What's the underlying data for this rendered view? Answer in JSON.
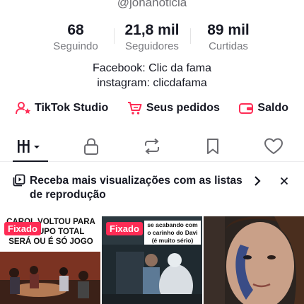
{
  "profile": {
    "handle": "@jonanoticia",
    "stats": [
      {
        "value": "68",
        "label": "Seguindo"
      },
      {
        "value": "21,8 mil",
        "label": "Seguidores"
      },
      {
        "value": "89 mil",
        "label": "Curtidas"
      }
    ],
    "bio": [
      "Facebook: Clic da fama",
      "instagram: clicdafama"
    ],
    "links": [
      {
        "label": "TikTok Studio",
        "icon": "person-star-icon"
      },
      {
        "label": "Seus pedidos",
        "icon": "cart-icon"
      },
      {
        "label": "Saldo",
        "icon": "wallet-icon"
      }
    ]
  },
  "tabs": [
    {
      "name": "videos",
      "icon": "grid-icon",
      "active": true
    },
    {
      "name": "private",
      "icon": "lock-icon"
    },
    {
      "name": "reposts",
      "icon": "repost-icon"
    },
    {
      "name": "favorites",
      "icon": "bookmark-icon"
    },
    {
      "name": "liked",
      "icon": "heart-icon"
    }
  ],
  "banner": {
    "text": "Receba mais visualizações com as listas de reprodução",
    "icon": "playlist-icon"
  },
  "videos": [
    {
      "pinned": "Fixado",
      "caption": "CAROL VOLTOU PARA O GRUPO TOTAL SERÁ OU É SÓ JOGO"
    },
    {
      "pinned": "Fixado",
      "caption": "se acabando com o carinho do Davi (é muito sério)"
    },
    {
      "caption": ""
    }
  ],
  "colors": {
    "accent": "#fe2c55",
    "text": "#161823",
    "muted": "#7a7b80"
  }
}
